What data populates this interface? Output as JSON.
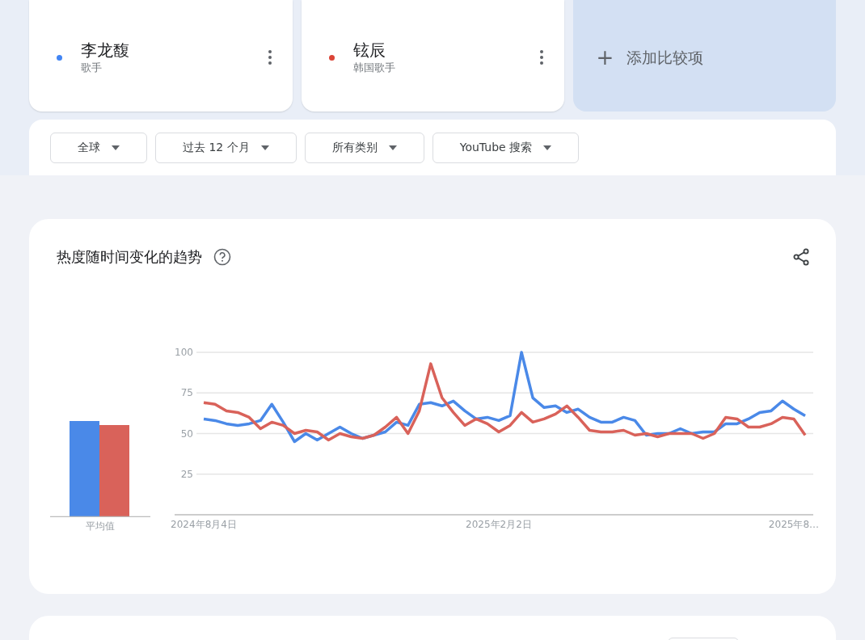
{
  "terms": [
    {
      "name": "李龙馥",
      "subtitle": "歌手",
      "color": "#4285f4"
    },
    {
      "name": "铉辰",
      "subtitle": "韩国歌手",
      "color": "#db4437"
    }
  ],
  "add_compare": {
    "icon": "+",
    "label": "添加比较项"
  },
  "filters": [
    {
      "label": "全球"
    },
    {
      "label": "过去 12 个月"
    },
    {
      "label": "所有类别"
    },
    {
      "label": "YouTube 搜索"
    }
  ],
  "trend_card": {
    "title": "热度随时间变化的趋势",
    "average_label": "平均值",
    "chart_data": {
      "type": "line",
      "categories": [
        "2024年8月4日",
        null,
        null,
        null,
        null,
        null,
        null,
        null,
        null,
        null,
        null,
        null,
        null,
        null,
        null,
        null,
        null,
        null,
        null,
        null,
        null,
        null,
        null,
        null,
        null,
        null,
        "2025年2月2日",
        null,
        null,
        null,
        null,
        null,
        null,
        null,
        null,
        null,
        null,
        null,
        null,
        null,
        null,
        null,
        null,
        null,
        null,
        null,
        null,
        null,
        null,
        null,
        null,
        null,
        "2025年8…",
        null
      ],
      "grid": true,
      "ylim": [
        0,
        100
      ],
      "yticks": [
        25,
        50,
        75,
        100
      ],
      "series": [
        {
          "color": "#4a89e8",
          "values": [
            59,
            58,
            56,
            55,
            56,
            58,
            68,
            57,
            45,
            50,
            46,
            50,
            54,
            50,
            47,
            49,
            51,
            57,
            55,
            68,
            69,
            67,
            70,
            64,
            59,
            60,
            58,
            61,
            100,
            72,
            66,
            67,
            63,
            65,
            60,
            57,
            57,
            60,
            58,
            49,
            50,
            50,
            53,
            50,
            51,
            51,
            56,
            56,
            59,
            63,
            64,
            70,
            65,
            61
          ]
        },
        {
          "color": "#d9625a",
          "values": [
            69,
            68,
            64,
            63,
            60,
            53,
            57,
            55,
            50,
            52,
            51,
            46,
            50,
            48,
            47,
            49,
            54,
            60,
            50,
            64,
            93,
            72,
            63,
            55,
            59,
            56,
            51,
            55,
            63,
            57,
            59,
            62,
            67,
            60,
            52,
            51,
            51,
            52,
            49,
            50,
            48,
            50,
            50,
            50,
            47,
            50,
            60,
            59,
            54,
            54,
            56,
            60,
            59,
            49
          ]
        }
      ]
    }
  }
}
